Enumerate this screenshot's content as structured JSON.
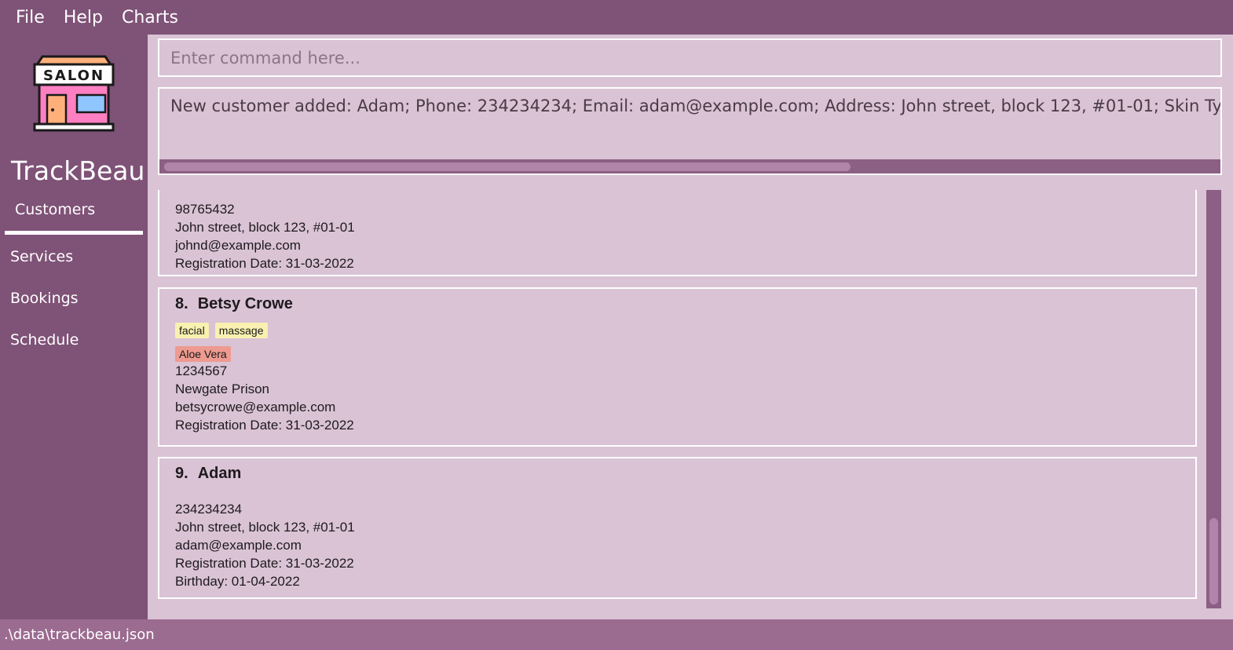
{
  "menu": {
    "items": [
      "File",
      "Help",
      "Charts"
    ]
  },
  "sidebar": {
    "logo_text": "SALON",
    "app_title": "TrackBeau",
    "nav": [
      "Customers",
      "Services",
      "Bookings",
      "Schedule"
    ],
    "active": "Customers"
  },
  "command": {
    "placeholder": "Enter command here..."
  },
  "result": {
    "text": "New customer added: Adam; Phone: 234234234; Email: adam@example.com; Address: John street, block 123, #01-01; Skin Type: No data; Hair Type: No data"
  },
  "customers": [
    {
      "phone": "98765432",
      "address": "John street, block 123, #01-01",
      "email": "johnd@example.com",
      "registration": "Registration Date: 31-03-2022"
    },
    {
      "index": "8.",
      "name": "Betsy Crowe",
      "tags": [
        "facial",
        "massage"
      ],
      "allergies": [
        "Aloe Vera"
      ],
      "phone": "1234567",
      "address": "Newgate Prison",
      "email": "betsycrowe@example.com",
      "registration": "Registration Date: 31-03-2022"
    },
    {
      "index": "9.",
      "name": "Adam",
      "phone": "234234234",
      "address": "John street, block 123, #01-01",
      "email": "adam@example.com",
      "registration": "Registration Date: 31-03-2022",
      "birthday": "Birthday: 01-04-2022"
    }
  ],
  "status": {
    "path": ".\\data\\trackbeau.json"
  },
  "colors": {
    "sidebar": "#7f5277",
    "panel": "#d9c3d5",
    "tag": "#f8f1b0",
    "allergy_tag": "#ee9a90"
  }
}
